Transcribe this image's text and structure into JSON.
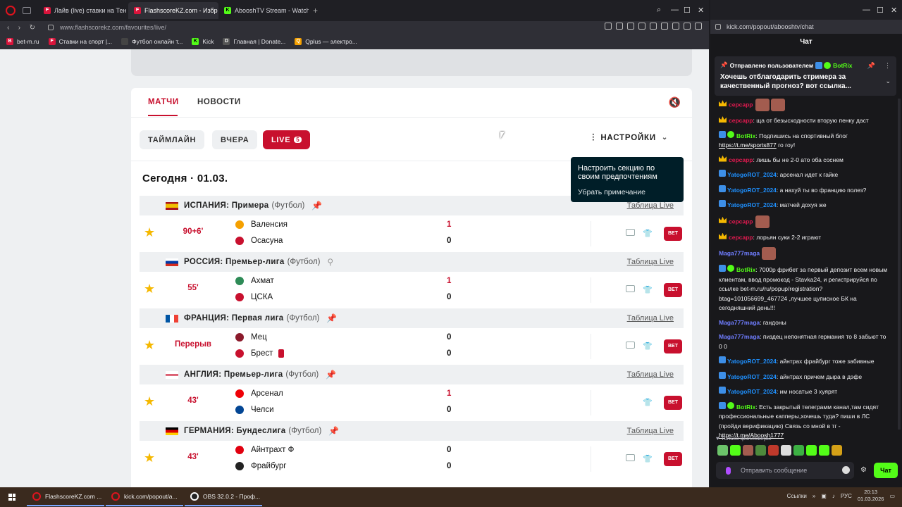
{
  "browser": {
    "tabs": [
      {
        "label": "Лайв (live) ставки на Тен"
      },
      {
        "label": "FlashscoreKZ.com - Избр"
      },
      {
        "label": "AbooshTV Stream - Watch"
      }
    ],
    "url": "www.flashscorekz.com/favourites/live/",
    "bookmarks": [
      {
        "label": "bet-m.ru"
      },
      {
        "label": "Ставки на спорт |..."
      },
      {
        "label": "Футбол онлайн т..."
      },
      {
        "label": "Kick"
      },
      {
        "label": "Главная | Donate..."
      },
      {
        "label": "Qplus — электро..."
      }
    ]
  },
  "page": {
    "tabs": {
      "matches": "МАТЧИ",
      "news": "НОВОСТИ"
    },
    "filters": {
      "timeline": "ТАЙМЛАЙН",
      "yesterday": "ВЧЕРА",
      "live": "LIVE",
      "live_count": "5"
    },
    "settings_label": "НАСТРОЙКИ",
    "today": "Сегодня · 01.03.",
    "tooltip": {
      "text": "Настроить секцию по своим предпочтениям",
      "dismiss": "Убрать примечание"
    },
    "table_link": "Таблица Live",
    "bet_label": "BET",
    "leagues": [
      {
        "country": "ИСПАНИЯ: Примера",
        "sport": "(Футбол)",
        "pinned": true,
        "match": {
          "time": "90+6'",
          "home": "Валенсия",
          "away": "Осасуна",
          "home_score": "1",
          "away_score": "0"
        }
      },
      {
        "country": "РОССИЯ: Премьер-лига",
        "sport": "(Футбол)",
        "pinned": false,
        "match": {
          "time": "55'",
          "home": "Ахмат",
          "away": "ЦСКА",
          "home_score": "1",
          "away_score": "0"
        }
      },
      {
        "country": "ФРАНЦИЯ: Первая лига",
        "sport": "(Футбол)",
        "pinned": true,
        "match": {
          "time": "Перерыв",
          "home": "Мец",
          "away": "Брест",
          "home_score": "0",
          "away_score": "0"
        }
      },
      {
        "country": "АНГЛИЯ: Премьер-лига",
        "sport": "(Футбол)",
        "pinned": true,
        "match": {
          "time": "43'",
          "home": "Арсенал",
          "away": "Челси",
          "home_score": "1",
          "away_score": "0"
        }
      },
      {
        "country": "ГЕРМАНИЯ: Бундеслига",
        "sport": "(Футбол)",
        "pinned": true,
        "match": {
          "time": "43'",
          "home": "Айнтрахт Ф",
          "away": "Фрайбург",
          "home_score": "0",
          "away_score": "0"
        }
      }
    ]
  },
  "chat_window": {
    "url": "kick.com/popout/abooshtv/chat",
    "title": "Чат",
    "pinned": {
      "by": "Отправлено пользователем",
      "user": "BotRix",
      "message": "Хочешь отблагодарить стримера за качественный прогноз? вот ссылка..."
    },
    "messages": [
      {
        "user": "cepcapp",
        "text": ""
      },
      {
        "user": "cepcapp",
        "text": ": ща от безысходности вторую пенку даст"
      },
      {
        "user": "BotRix",
        "text": ": Подпишись на спортивный блог ",
        "link": "https://t.me/sports877",
        "after": " го гоу!"
      },
      {
        "user": "cepcapp",
        "text": ": лишь бы не 2-0 ато оба соснем"
      },
      {
        "user": "YatogoROT_2024",
        "text": ": арсенал идет к гайке"
      },
      {
        "user": "YatogoROT_2024",
        "text": ": а нахуй ты во францию полез?"
      },
      {
        "user": "YatogoROT_2024",
        "text": ": матчей дохуя же"
      },
      {
        "user": "cepcapp",
        "text": ""
      },
      {
        "user": "cepcapp",
        "text": ": лорьян суки 2-2 играют"
      },
      {
        "user": "Maga777maga",
        "text": ""
      },
      {
        "user": "BotRix",
        "text": ": 7000р фрибет за первый депозит всем новым клиентам, ввод промокод - Stavka24, и регистрируйся по ссылке bet-m.ru/ru/popup/registration?btag=101056699_467724 ,лучшее цуписное БК на сегодняшний день!!!"
      },
      {
        "user": "Maga777maga",
        "text": ": гандоны"
      },
      {
        "user": "Maga777maga",
        "text": ": пиздец непонятная германия то 8 забьют то 0 0"
      },
      {
        "user": "YatogoROT_2024",
        "text": ": айнтрах фрайбург тоже забивные"
      },
      {
        "user": "YatogoROT_2024",
        "text": ": айнтрах причем дыра в дэфе"
      },
      {
        "user": "YatogoROT_2024",
        "text": ": им носатые 3 хуярят"
      },
      {
        "user": "BotRix",
        "text": ": Есть закрытый телеграмм канал,там сидят профессиональные капперы,хочешь туда? пиши в ЛС (пройди верификацию) Связь со мной в тг - ",
        "link": "https://t.me/Aboosh1777",
        "after": ""
      }
    ],
    "followers_only": "Только фолловеры",
    "input_placeholder": "Отправить сообщение",
    "send_label": "Чат"
  },
  "taskbar": {
    "apps": [
      {
        "label": "FlashscoreKZ.com ..."
      },
      {
        "label": "kick.com/popout/a..."
      },
      {
        "label": "OBS 32.0.2 - Проф..."
      }
    ],
    "tray": {
      "links": "Ссылки",
      "lang": "РУС",
      "time": "20:13",
      "date": "01.03.2026"
    }
  },
  "colors": {
    "accent": "#c8102e",
    "kick_green": "#53fc18",
    "pin_blue": "#0c88e0",
    "star": "#f5b800"
  }
}
